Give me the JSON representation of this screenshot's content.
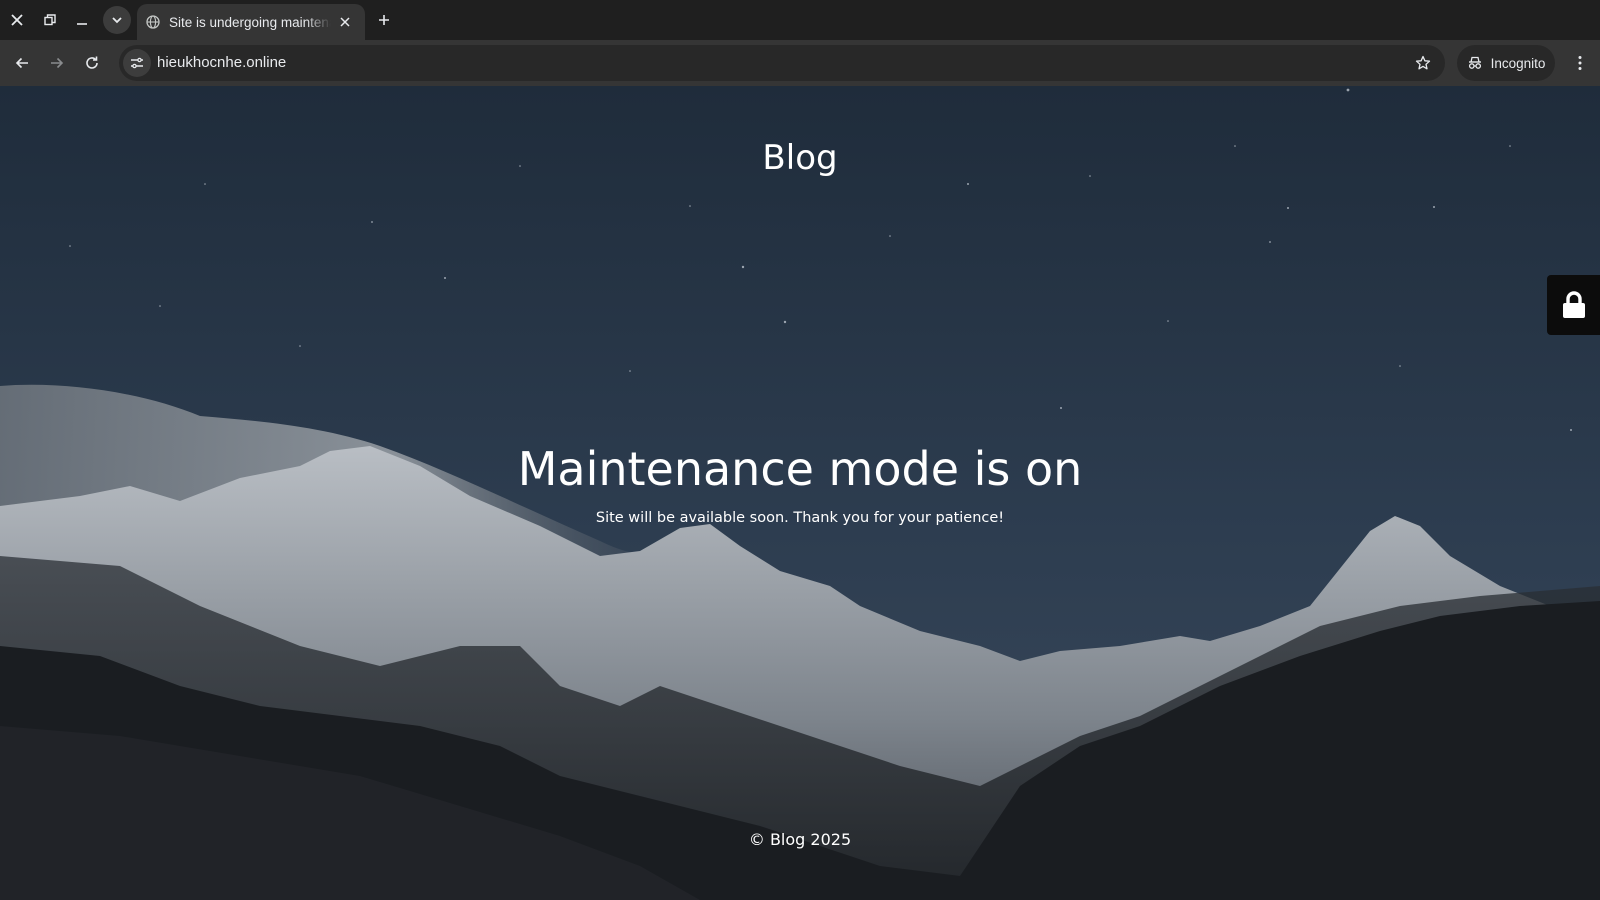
{
  "browser": {
    "tab": {
      "title": "Site is undergoing maintenance",
      "favicon_icon": "globe-icon",
      "close_icon": "close-icon"
    },
    "window_controls": [
      "close-icon",
      "restore-icon",
      "minimize-icon"
    ],
    "tab_search_icon": "chevron-down-icon",
    "new_tab_icon": "plus-icon",
    "nav": [
      "back-arrow-icon",
      "forward-arrow-icon",
      "reload-icon"
    ],
    "address_bar": {
      "url": "hieukhocnhe.online",
      "site_info_icon": "tune-icon",
      "bookmark_icon": "star-icon"
    },
    "incognito": {
      "label": "Incognito",
      "icon": "incognito-icon"
    },
    "menu_icon": "more-vert-icon"
  },
  "page": {
    "site_title": "Blog",
    "headline": "Maintenance mode is on",
    "message": "Site will be available soon. Thank you for your patience!",
    "footer": "© Blog 2025",
    "login_icon": "lock-icon"
  },
  "colors": {
    "chrome_dark": "#1f1f1f",
    "toolbar": "#353535",
    "sky": "#273444",
    "text": "#ffffff"
  }
}
